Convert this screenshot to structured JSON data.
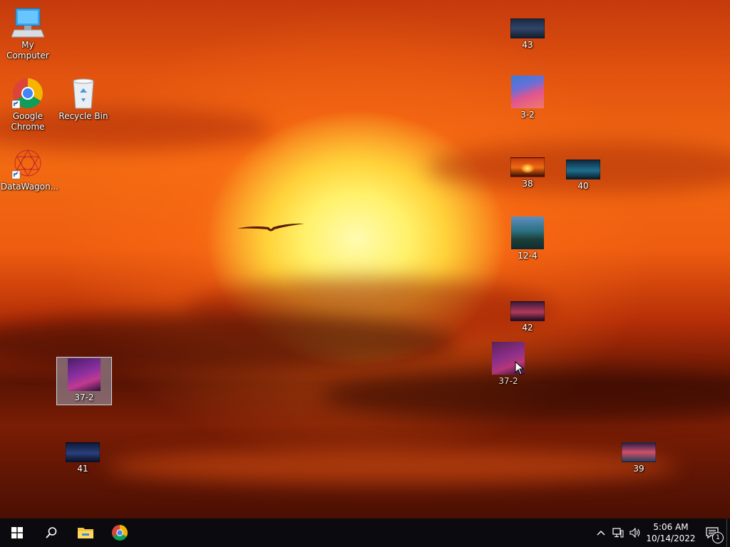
{
  "desktop": {
    "icons": {
      "my_computer": {
        "label": "My Computer"
      },
      "google_chrome": {
        "label": "Google\nChrome"
      },
      "recycle_bin": {
        "label": "Recycle Bin"
      },
      "datawagon": {
        "label": "DataWagon..."
      },
      "img_43": {
        "label": "43"
      },
      "img_3_2": {
        "label": "3-2"
      },
      "img_38": {
        "label": "38"
      },
      "img_40": {
        "label": "40"
      },
      "img_12_4": {
        "label": "12-4"
      },
      "img_42": {
        "label": "42"
      },
      "img_37_2_drag": {
        "label": "37-2"
      },
      "img_37_2_selected": {
        "label": "37-2"
      },
      "img_41": {
        "label": "41"
      },
      "img_39": {
        "label": "39"
      }
    }
  },
  "taskbar": {
    "clock": {
      "time": "5:06 AM",
      "date": "10/14/2022"
    },
    "notification_count": "1"
  },
  "colors": {
    "taskbar_bg": "#0b0b0f",
    "selection": "#aabedc"
  }
}
